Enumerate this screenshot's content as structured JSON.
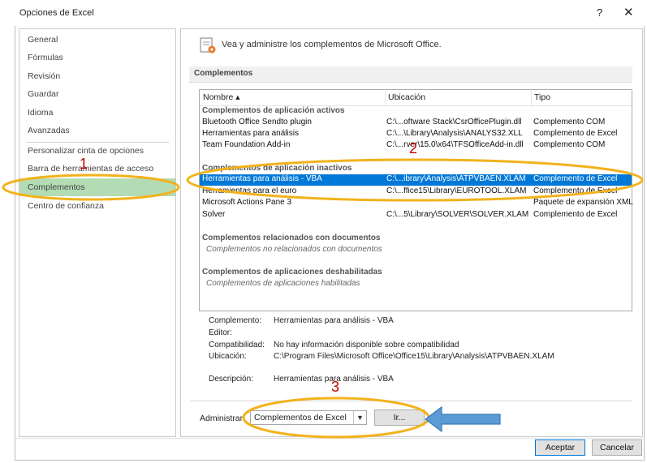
{
  "window": {
    "title": "Opciones de Excel",
    "help_glyph": "?",
    "close_glyph": "✕"
  },
  "sidebar": {
    "items": [
      {
        "label": "General"
      },
      {
        "label": "Fórmulas"
      },
      {
        "label": "Revisión"
      },
      {
        "label": "Guardar"
      },
      {
        "label": "Idioma"
      },
      {
        "label": "Avanzadas"
      },
      {
        "label": "Personalizar cinta de opciones"
      },
      {
        "label": "Barra de herramientas de acceso rápido"
      },
      {
        "label": "Complementos",
        "selected": true
      },
      {
        "label": "Centro de confianza"
      }
    ]
  },
  "main": {
    "intro": "Vea y administre los complementos de Microsoft Office.",
    "section_title": "Complementos",
    "columns": {
      "name": "Nombre ▴",
      "location": "Ubicación",
      "type": "Tipo"
    },
    "groups": {
      "active": {
        "title": "Complementos de aplicación activos",
        "rows": [
          {
            "name": "Bluetooth Office Sendto plugin",
            "location": "C:\\...oftware Stack\\CsrOfficePlugin.dll",
            "type": "Complemento COM"
          },
          {
            "name": "Herramientas para análisis",
            "location": "C:\\...\\Library\\Analysis\\ANALYS32.XLL",
            "type": "Complemento de Excel"
          },
          {
            "name": "Team Foundation Add-in",
            "location": "C:\\...rver\\15.0\\x64\\TFSOfficeAdd-in.dll",
            "type": "Complemento COM"
          }
        ]
      },
      "inactive": {
        "title": "Complementos de aplicación inactivos",
        "rows": [
          {
            "name": "Herramientas para análisis - VBA",
            "location": "C:\\...ibrary\\Analysis\\ATPVBAEN.XLAM",
            "type": "Complemento de Excel",
            "selected": true
          },
          {
            "name": "Herramientas para el euro",
            "location": "C:\\...ffice15\\Library\\EUROTOOL.XLAM",
            "type": "Complemento de Excel"
          },
          {
            "name": "Microsoft Actions Pane 3",
            "location": "",
            "type": "Paquete de expansión XML"
          },
          {
            "name": "Solver",
            "location": "C:\\...5\\Library\\SOLVER\\SOLVER.XLAM",
            "type": "Complemento de Excel"
          }
        ]
      },
      "documents": {
        "title": "Complementos relacionados con documentos",
        "empty": "Complementos no relacionados con documentos"
      },
      "disabled": {
        "title": "Complementos de aplicaciones deshabilitadas",
        "empty": "Complementos de aplicaciones habilitadas"
      }
    },
    "details": {
      "addin_label": "Complemento:",
      "addin_value": "Herramientas para análisis - VBA",
      "editor_label": "Editor:",
      "compat_label": "Compatibilidad:",
      "compat_value": "No hay información disponible sobre compatibilidad",
      "location_label": "Ubicación:",
      "location_value": "C:\\Program Files\\Microsoft Office\\Office15\\Library\\Analysis\\ATPVBAEN.XLAM",
      "desc_label": "Descripción:",
      "desc_value": "Herramientas para análisis - VBA"
    },
    "manage": {
      "label": "Administrar:",
      "selected": "Complementos de Excel",
      "go_button": "Ir..."
    }
  },
  "footer": {
    "ok": "Aceptar",
    "cancel": "Cancelar"
  },
  "annotations": {
    "n1": "1",
    "n2": "2",
    "n3": "3",
    "ellipse_color": "#f2b21c",
    "arrow_color": "#5b9bd5",
    "number_color": "#c00000"
  }
}
